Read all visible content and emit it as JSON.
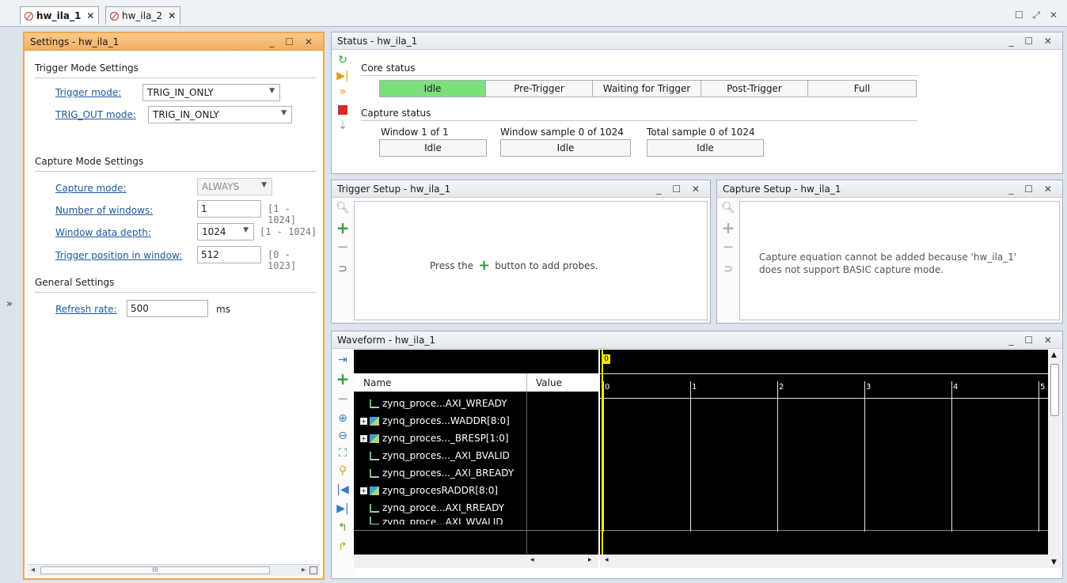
{
  "tabs": [
    {
      "label": "hw_ila_1",
      "active": true
    },
    {
      "label": "hw_ila_2",
      "active": false
    }
  ],
  "window_controls": "☐ ⤢ ✕",
  "panel_controls": "_ ☐ ✕",
  "left_strip_expand": "»",
  "settings": {
    "title": "Settings - hw_ila_1",
    "trigger_mode_section": "Trigger Mode Settings",
    "trigger_mode_label": "Trigger mode:",
    "trigger_mode_value": "TRIG_IN_ONLY",
    "trig_out_label": "TRIG_OUT mode:",
    "trig_out_value": "TRIG_IN_ONLY",
    "capture_mode_section": "Capture Mode Settings",
    "capture_mode_label": "Capture mode:",
    "capture_mode_value": "ALWAYS",
    "num_windows_label": "Number of windows:",
    "num_windows_value": "1",
    "num_windows_range": "[1 - 1024]",
    "window_depth_label": "Window data depth:",
    "window_depth_value": "1024",
    "window_depth_range": "[1 - 1024]",
    "trigger_pos_label": "Trigger position in window:",
    "trigger_pos_value": "512",
    "trigger_pos_range": "[0 - 1023]",
    "general_section": "General Settings",
    "refresh_label": "Refresh rate:",
    "refresh_value": "500",
    "refresh_unit": "ms",
    "scroll_thumb": "III"
  },
  "status": {
    "title": "Status - hw_ila_1",
    "core_status_label": "Core status",
    "core_states": [
      "Idle",
      "Pre-Trigger",
      "Waiting for Trigger",
      "Post-Trigger",
      "Full"
    ],
    "active_state": "Idle",
    "capture_status_label": "Capture status",
    "window_label": "Window 1 of 1",
    "window_value": "Idle",
    "window_sample_label": "Window sample 0 of 1024",
    "window_sample_value": "Idle",
    "total_sample_label": "Total sample 0 of 1024",
    "total_sample_value": "Idle",
    "active_color": "#7be07b"
  },
  "trigger_setup": {
    "title": "Trigger Setup - hw_ila_1",
    "hint_before": "Press the",
    "hint_after": "button to add probes."
  },
  "capture_setup": {
    "title": "Capture Setup - hw_ila_1",
    "message_line1": "Capture equation cannot be added because 'hw_ila_1'",
    "message_line2": "does not support BASIC capture mode."
  },
  "waveform": {
    "title": "Waveform - hw_ila_1",
    "col_name": "Name",
    "col_value": "Value",
    "marker_label": "0",
    "ticks": [
      "0",
      "1",
      "2",
      "3",
      "4",
      "5"
    ],
    "signals": [
      {
        "name": "zynq_proce...AXI_WREADY",
        "bus": false
      },
      {
        "name": "zynq_proces...WADDR[8:0]",
        "bus": true
      },
      {
        "name": "zynq_proces..._BRESP[1:0]",
        "bus": true
      },
      {
        "name": "zynq_proces..._AXI_BVALID",
        "bus": false
      },
      {
        "name": "zynq_proces..._AXI_BREADY",
        "bus": false
      },
      {
        "name": "zynq_procesRADDR[8:0]",
        "bus": true
      },
      {
        "name": "zynq_proce...AXI_RREADY",
        "bus": false
      },
      {
        "name": "zynq_proce...AXI_WVALID",
        "bus": false
      }
    ]
  }
}
